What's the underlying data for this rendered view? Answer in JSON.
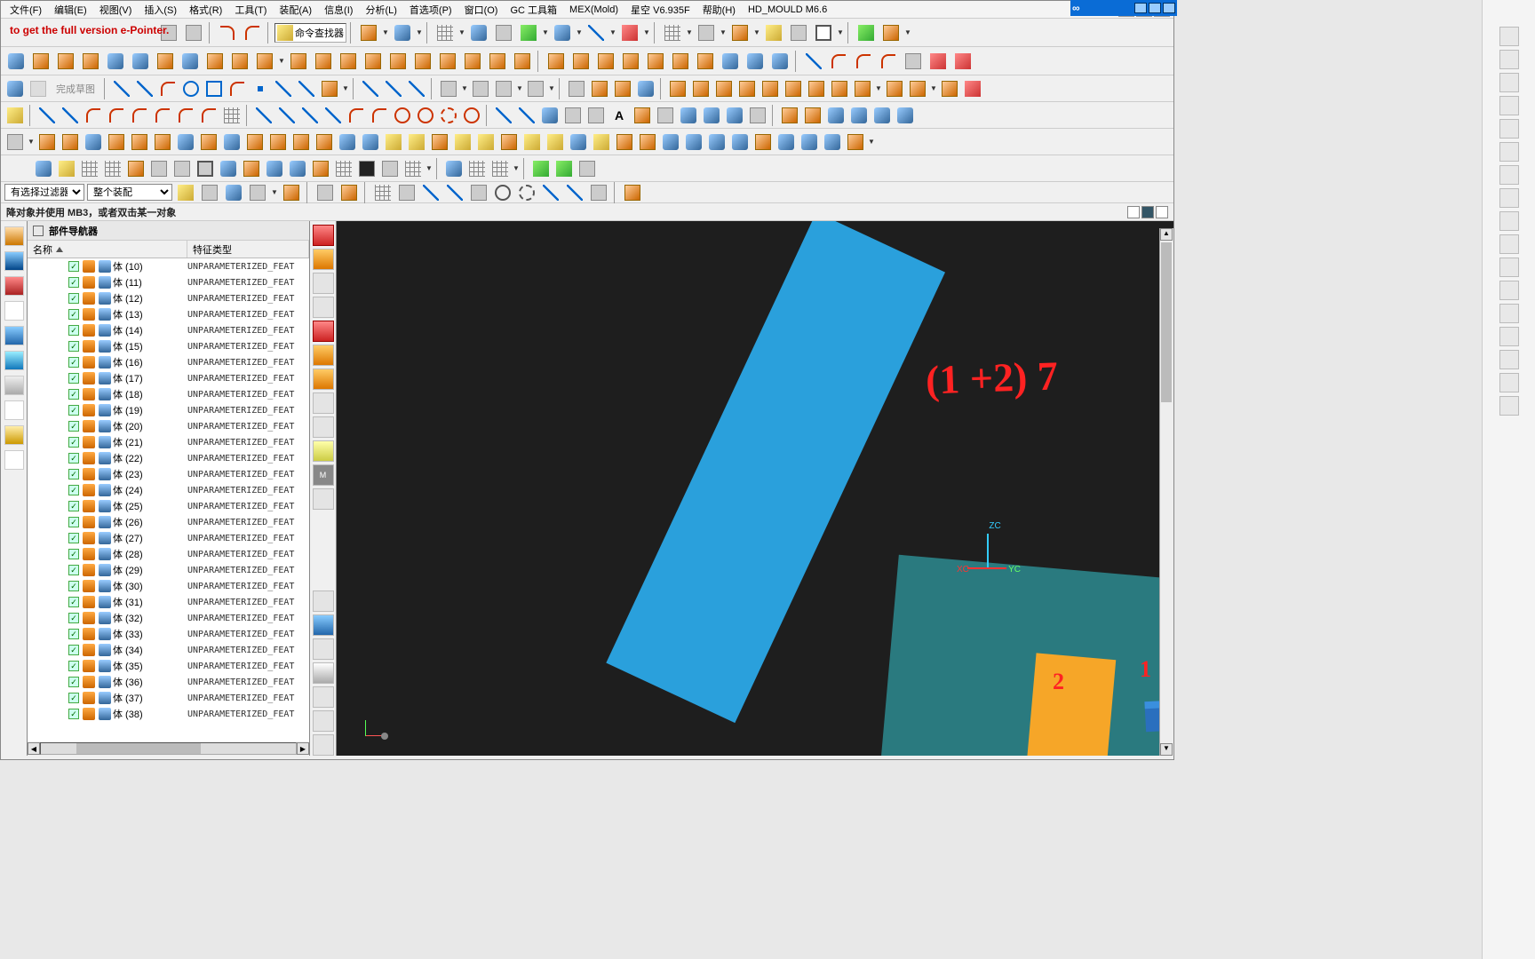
{
  "menu": {
    "file": "文件(F)",
    "edit": "编辑(E)",
    "view": "视图(V)",
    "insert": "插入(S)",
    "format": "格式(R)",
    "tools": "工具(T)",
    "assembly": "装配(A)",
    "info": "信息(I)",
    "analyze": "分析(L)",
    "pref": "首选项(P)",
    "window": "窗口(O)",
    "gc": "GC 工具箱",
    "mex": "MEX(Mold)",
    "star": "星空  V6.935F",
    "help": "帮助(H)",
    "hd": "HD_MOULD  M6.6"
  },
  "banner": "to get the full version e-Pointer.",
  "cmd_finder_label": "命令查找器",
  "sketch_done": "完成草图",
  "filter": {
    "label1": "有选择过滤器",
    "label2": "整个装配"
  },
  "prompt": "降对象并使用 MB3，或者双击某一对象",
  "navigator": {
    "title": "部件导航器",
    "col_name": "名称",
    "col_type": "特征类型",
    "body_label": "体",
    "feature_type": "UNPARAMETERIZED_FEAT",
    "rows": [
      10,
      11,
      12,
      13,
      14,
      15,
      16,
      17,
      18,
      19,
      20,
      21,
      22,
      23,
      24,
      25,
      26,
      27,
      28,
      29,
      30,
      31,
      32,
      33,
      34,
      35,
      36,
      37,
      38
    ]
  },
  "triad": {
    "x": "XC",
    "y": "YC",
    "z": "ZC"
  },
  "annotation_main": "(1 +2) 7",
  "annotation_small1": "2",
  "annotation_small2": "1",
  "chart_data": null
}
